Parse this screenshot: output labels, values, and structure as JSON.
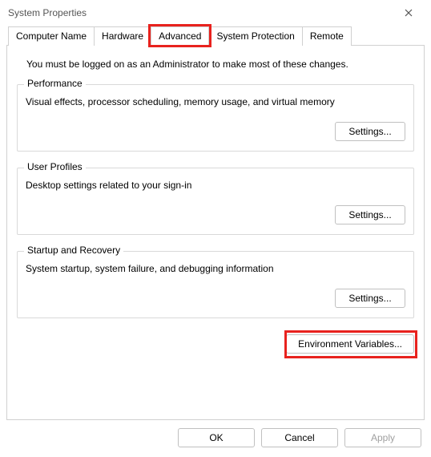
{
  "window": {
    "title": "System Properties"
  },
  "tabs": {
    "computer_name": "Computer Name",
    "hardware": "Hardware",
    "advanced": "Advanced",
    "system_protection": "System Protection",
    "remote": "Remote",
    "active": "advanced"
  },
  "admin_note": "You must be logged on as an Administrator to make most of these changes.",
  "performance": {
    "title": "Performance",
    "desc": "Visual effects, processor scheduling, memory usage, and virtual memory",
    "button": "Settings..."
  },
  "user_profiles": {
    "title": "User Profiles",
    "desc": "Desktop settings related to your sign-in",
    "button": "Settings..."
  },
  "startup_recovery": {
    "title": "Startup and Recovery",
    "desc": "System startup, system failure, and debugging information",
    "button": "Settings..."
  },
  "env_button": "Environment Variables...",
  "dialog_buttons": {
    "ok": "OK",
    "cancel": "Cancel",
    "apply": "Apply"
  },
  "highlights": {
    "advanced_tab": true,
    "env_variables": true
  }
}
